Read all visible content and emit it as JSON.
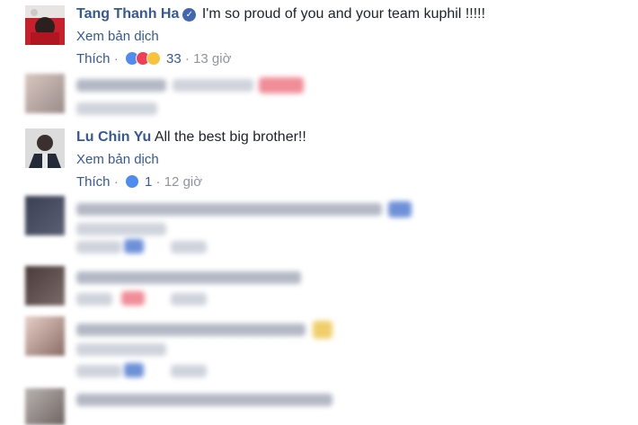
{
  "comments": [
    {
      "author": "Tang Thanh Ha",
      "verified": true,
      "text": "I'm so proud of you and your team kuphil !!!!!",
      "translate_label": "Xem bản dịch",
      "like_label": "Thích",
      "reactions": [
        "like-reaction-icon",
        "love-reaction-icon",
        "haha-reaction-icon"
      ],
      "reaction_count": "33",
      "time": "13 giờ"
    },
    {
      "author": "Lu Chin Yu",
      "verified": false,
      "text": "All the best big brother!!",
      "translate_label": "Xem bản dịch",
      "like_label": "Thích",
      "reactions": [
        "like-reaction-icon"
      ],
      "reaction_count": "1",
      "time": "12 giờ"
    }
  ],
  "separator": "·",
  "colors": {
    "link_blue": "#365899",
    "meta_gray": "#90949c",
    "text_dark": "#1d2129",
    "verified_blue": "#4267b2",
    "like_blue": "#4f8cf0",
    "love_red": "#ef3e56",
    "haha_yellow": "#f9c23c"
  }
}
